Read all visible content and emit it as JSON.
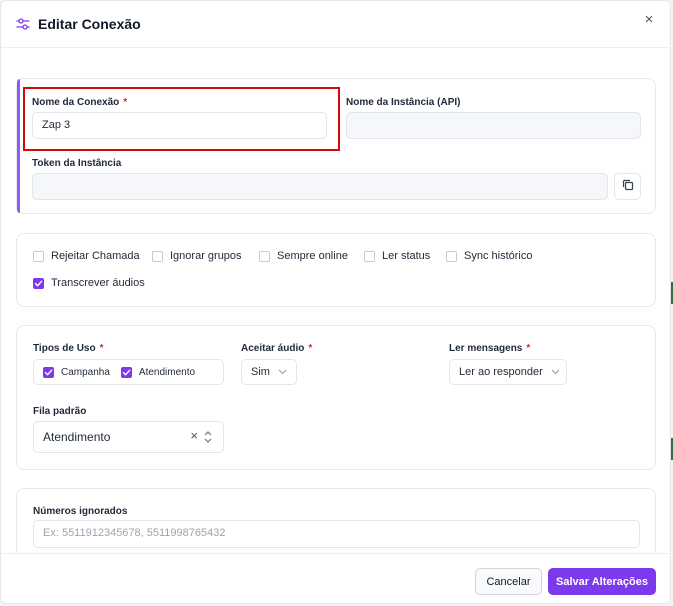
{
  "dialog": {
    "title": "Editar Conexão",
    "close": "×"
  },
  "connection": {
    "name_label": "Nome da Conexão",
    "name_required": "*",
    "name_value": "Zap 3",
    "instance_label": "Nome da Instância (API)",
    "instance_value": "",
    "token_label": "Token da Instância",
    "token_value": ""
  },
  "options": [
    {
      "label": "Rejeitar Chamada",
      "checked": false
    },
    {
      "label": "Ignorar grupos",
      "checked": false
    },
    {
      "label": "Sempre online",
      "checked": false
    },
    {
      "label": "Ler status",
      "checked": false
    },
    {
      "label": "Sync histórico",
      "checked": false
    },
    {
      "label": "Transcrever áudios",
      "checked": true
    }
  ],
  "usage": {
    "types_label": "Tipos de Uso",
    "types_required": "*",
    "type_campaign": "Campanha",
    "type_service": "Atendimento",
    "audio_label": "Aceitar áudio",
    "audio_required": "*",
    "audio_value": "Sim",
    "read_label": "Ler mensagens",
    "read_required": "*",
    "read_value": "Ler ao responder",
    "queue_label": "Fila padrão",
    "queue_value": "Atendimento",
    "queue_clear": "×"
  },
  "ignored": {
    "label": "Números ignorados",
    "placeholder": "Ex: 5511912345678, 5511998765432"
  },
  "footer": {
    "cancel": "Cancelar",
    "save": "Salvar Alterações"
  },
  "colors": {
    "accent": "#7c3aed",
    "highlight": "#d10a0a",
    "required": "#dc2626"
  }
}
